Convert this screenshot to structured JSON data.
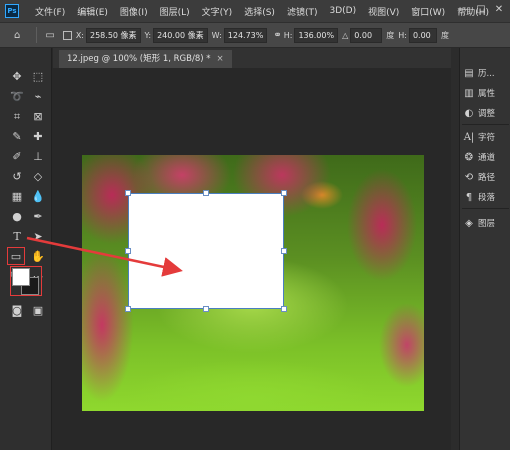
{
  "app": {
    "logo": "Ps"
  },
  "menu": [
    "文件(F)",
    "编辑(E)",
    "图像(I)",
    "图层(L)",
    "文字(Y)",
    "选择(S)",
    "滤镜(T)",
    "3D(D)",
    "视图(V)",
    "窗口(W)",
    "帮助(H)"
  ],
  "window_controls": {
    "minimize": "—",
    "maximize": "□",
    "close": "✕"
  },
  "options": {
    "x_label": "X:",
    "x_value": "258.50 像素",
    "y_label": "Y:",
    "y_value": "240.00 像素",
    "w_label": "W:",
    "w_value": "124.73%",
    "h_label": "H:",
    "h_value": "136.00%",
    "angle_label": "△",
    "angle_value": "0.00",
    "angle_unit": "度",
    "hskew_label": "H:",
    "hskew_value": "0.00",
    "hskew_unit": "度"
  },
  "document": {
    "tab_label": "12.jpeg @ 100% (矩形 1, RGB/8) *",
    "close": "×"
  },
  "right_panels": [
    {
      "icon": "history-icon",
      "label": "历..."
    },
    {
      "icon": "properties-icon",
      "label": "属性"
    },
    {
      "icon": "adjustments-icon",
      "label": "调整"
    },
    {
      "icon": "character-icon",
      "label": "字符"
    },
    {
      "icon": "channels-icon",
      "label": "通道"
    },
    {
      "icon": "paths-icon",
      "label": "路径"
    },
    {
      "icon": "paragraph-icon",
      "label": "段落"
    },
    {
      "icon": "layers-icon",
      "label": "图层"
    }
  ],
  "colors": {
    "foreground": "#ffffff",
    "background": "#1a1a1a",
    "highlight": "#e43b3b",
    "selection": "#4a7fc0"
  }
}
